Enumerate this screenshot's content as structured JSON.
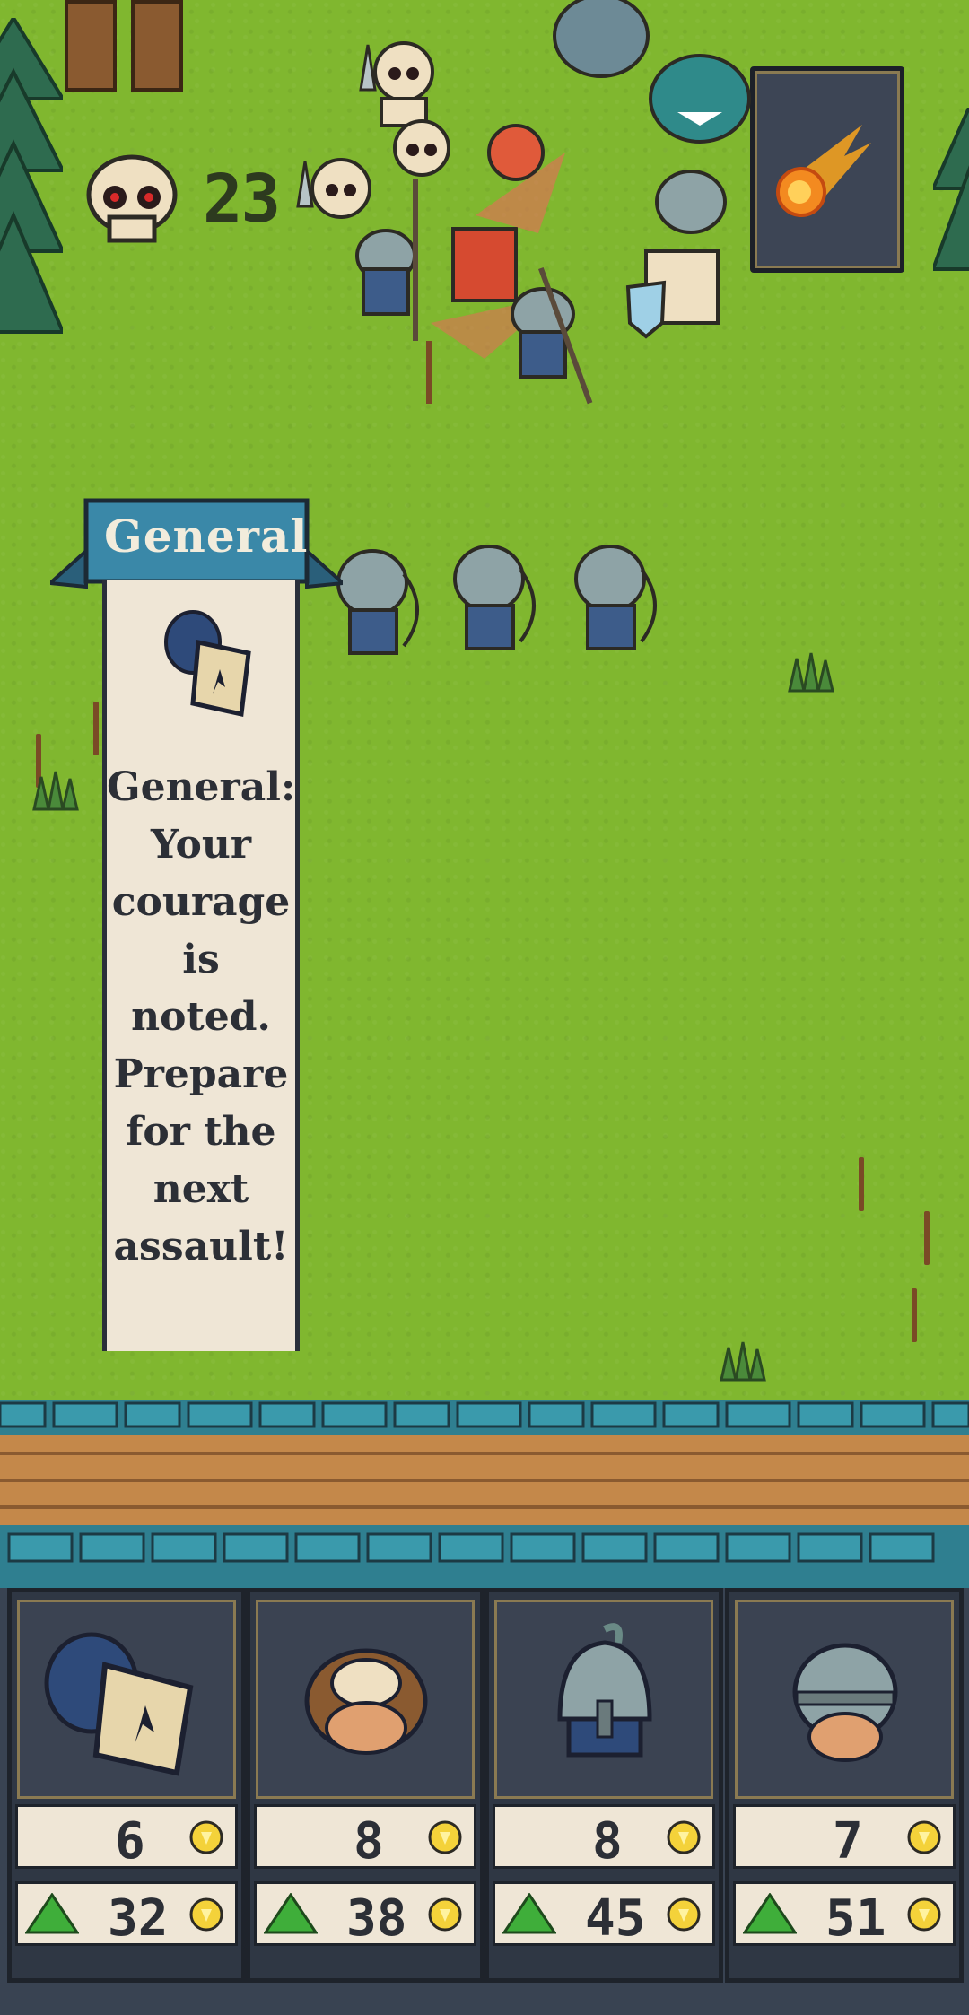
{
  "hud": {
    "kills": "23",
    "kills_icon": "skull-icon",
    "skill_icon": "fireball-icon"
  },
  "dialog": {
    "title": "General",
    "speaker_icon": "general-helmet-icon",
    "message": "General: Your courage is noted. Prepare for the next assault!"
  },
  "shop": {
    "cards": [
      {
        "name": "general",
        "icon": "general-helmet-icon",
        "cost": "6",
        "price": "32"
      },
      {
        "name": "peasant",
        "icon": "peasant-head-icon",
        "cost": "8",
        "price": "38"
      },
      {
        "name": "spearman",
        "icon": "plumed-helmet-icon",
        "cost": "8",
        "price": "45"
      },
      {
        "name": "archer",
        "icon": "round-helmet-icon",
        "cost": "7",
        "price": "51"
      }
    ],
    "cost_icon": "gold-coin-icon",
    "price_icon": "green-gem-icon"
  },
  "colors": {
    "grass": "#80b72f",
    "wall_stone": "#2f7f90",
    "wall_dirt": "#c4884a",
    "panel": "#394352",
    "parchment": "#efe6d6",
    "gold": "#f4d23a",
    "gem": "#3fae3a"
  }
}
